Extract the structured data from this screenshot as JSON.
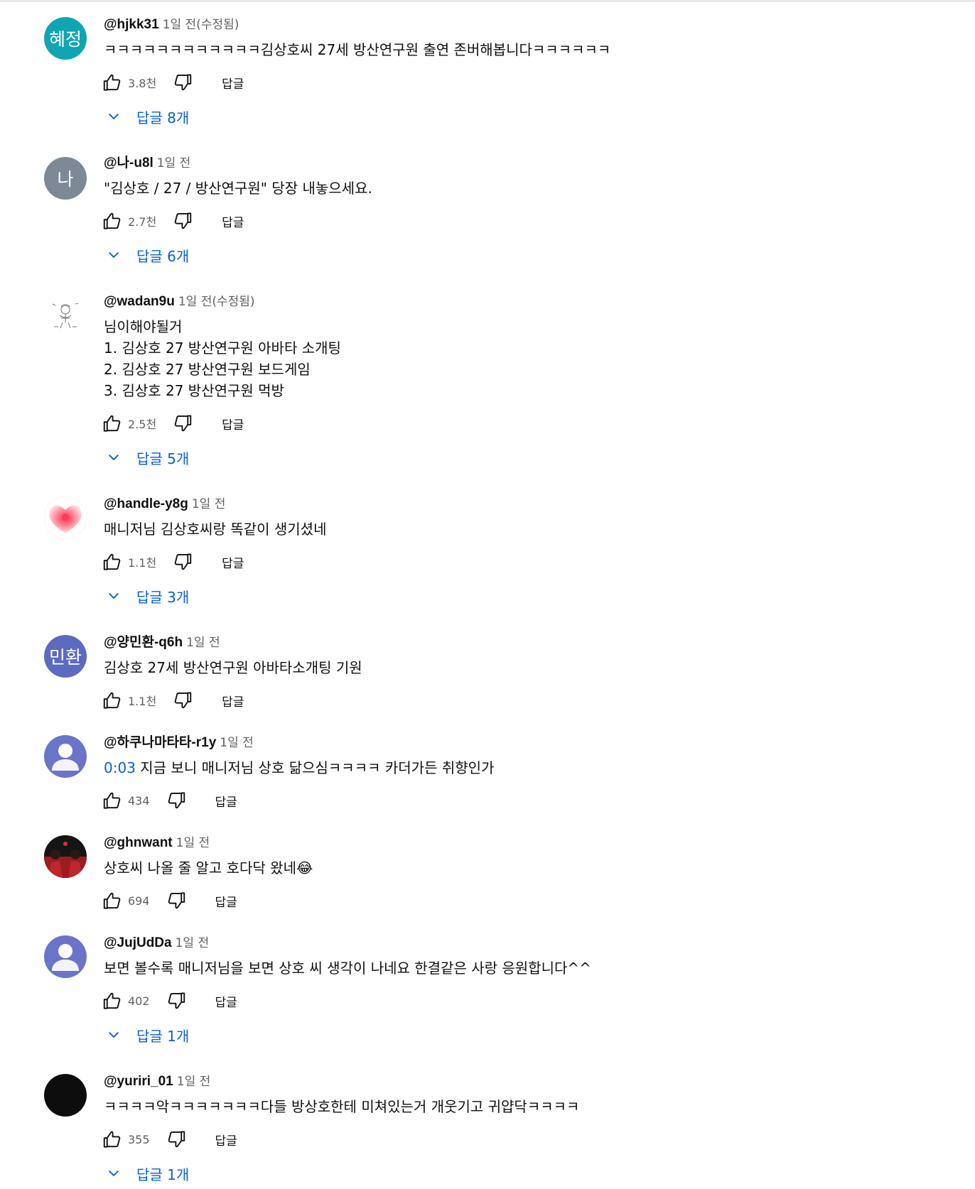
{
  "reply_label": "답글",
  "comments": [
    {
      "handle": "@hjkk31",
      "time": "1일 전(수정됨)",
      "avatar": {
        "type": "text",
        "text": "혜정",
        "color": "#11a5b4"
      },
      "lines": [
        "ㅋㅋㅋㅋㅋㅋㅋㅋㅋㅋㅋㅋ김상호씨 27세 방산연구원 출연 존버해봅니다ㅋㅋㅋㅋㅋㅋ"
      ],
      "likes": "3.8천",
      "replies": "답글 8개"
    },
    {
      "handle": "@나-u8l",
      "time": "1일 전",
      "avatar": {
        "type": "text",
        "text": "나",
        "color": "#7b8a96"
      },
      "lines": [
        "\"김상호 / 27 / 방산연구원\" 당장 내놓으세요."
      ],
      "likes": "2.7천",
      "replies": "답글 6개"
    },
    {
      "handle": "@wadan9u",
      "time": "1일 전(수정됨)",
      "avatar": {
        "type": "sketch",
        "color": "#ffffff"
      },
      "lines": [
        "님이해야될거",
        "1. 김상호 27 방산연구원 아바타 소개팅",
        "2. 김상호 27 방산연구원 보드게임",
        "3. 김상호 27 방산연구원 먹방"
      ],
      "likes": "2.5천",
      "replies": "답글 5개"
    },
    {
      "handle": "@handle-y8g",
      "time": "1일 전",
      "avatar": {
        "type": "heart",
        "color": "#f06a7a"
      },
      "lines": [
        "매니저님 김상호씨랑 똑같이 생기셨네"
      ],
      "likes": "1.1천",
      "replies": "답글 3개"
    },
    {
      "handle": "@양민환-q6h",
      "time": "1일 전",
      "avatar": {
        "type": "text",
        "text": "민환",
        "color": "#5c6bc0"
      },
      "lines": [
        "김상호 27세 방산연구원 아바타소개팅 기원"
      ],
      "likes": "1.1천",
      "replies": ""
    },
    {
      "handle": "@하쿠나마타타-r1y",
      "time": "1일 전",
      "avatar": {
        "type": "default",
        "color": "#6a75c9"
      },
      "timestamp_link": "0:03",
      "lines": [
        " 지금 보니 매니저님 상호 닮으심ㅋㅋㅋㅋ 카더가든 취향인가"
      ],
      "likes": "434",
      "replies": ""
    },
    {
      "handle": "@ghnwant",
      "time": "1일 전",
      "avatar": {
        "type": "photo",
        "color": "#9e1b20"
      },
      "lines": [
        "상호씨 나올 줄 알고 호다닥 왔네😂"
      ],
      "likes": "694",
      "replies": ""
    },
    {
      "handle": "@JujUdDa",
      "time": "1일 전",
      "avatar": {
        "type": "default",
        "color": "#6a75c9"
      },
      "lines": [
        "보면 볼수록 매니저님을 보면 상호 씨 생각이 나네요 한결같은 사랑 응원합니다^^"
      ],
      "likes": "402",
      "replies": "답글 1개"
    },
    {
      "handle": "@yuriri_01",
      "time": "1일 전",
      "avatar": {
        "type": "dark",
        "color": "#0d0d0d"
      },
      "lines": [
        "ㅋㅋㅋㅋ악ㅋㅋㅋㅋㅋㅋㅋ다들 방상호한테 미쳐있는거 개웃기고 귀얍닥ㅋㅋㅋㅋ"
      ],
      "likes": "355",
      "replies": "답글 1개"
    }
  ]
}
